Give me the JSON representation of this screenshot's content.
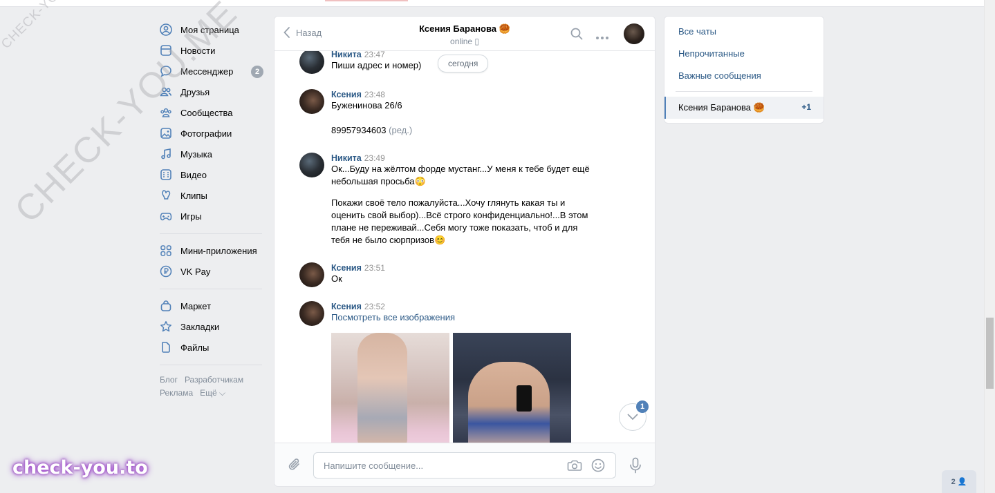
{
  "nav": {
    "items": [
      {
        "label": "Моя страница",
        "icon": "user-circle-icon"
      },
      {
        "label": "Новости",
        "icon": "news-icon"
      },
      {
        "label": "Мессенджер",
        "icon": "message-icon",
        "badge": "2"
      },
      {
        "label": "Друзья",
        "icon": "friends-icon"
      },
      {
        "label": "Сообщества",
        "icon": "communities-icon"
      },
      {
        "label": "Фотографии",
        "icon": "photos-icon"
      },
      {
        "label": "Музыка",
        "icon": "music-icon"
      },
      {
        "label": "Видео",
        "icon": "video-icon"
      },
      {
        "label": "Клипы",
        "icon": "clips-icon"
      },
      {
        "label": "Игры",
        "icon": "games-icon"
      },
      {
        "label": "Мини-приложения",
        "icon": "apps-icon"
      },
      {
        "label": "VK Pay",
        "icon": "vkpay-icon"
      },
      {
        "label": "Маркет",
        "icon": "market-icon"
      },
      {
        "label": "Закладки",
        "icon": "star-icon"
      },
      {
        "label": "Файлы",
        "icon": "file-icon"
      }
    ],
    "footer": {
      "blog": "Блог",
      "devs": "Разработчикам",
      "ads": "Реклама",
      "more": "Ещё ⌵"
    }
  },
  "chat": {
    "back_label": "Назад",
    "title": "Ксения Баранова 🥮",
    "status": "online ▯",
    "today_label": "сегодня",
    "messages": [
      {
        "author": "Никита",
        "time": "23:47",
        "text": "Пиши адрес и номер)"
      },
      {
        "author": "Ксения",
        "time": "23:48",
        "text": "Буженинова 26/6",
        "text2": "89957934603",
        "edited": "(ред.)"
      },
      {
        "author": "Никита",
        "time": "23:49",
        "text_l1": "Ок...Буду на жёлтом форде мустанг...У меня к тебе будет ещё",
        "text_l2": "небольшая просьба😳",
        "text2_l1": "Покажи своё тело пожалуйста...Хочу глянуть какая ты и",
        "text2_l2": "оценить свой выбор)...Всё строго конфиденциально!...В этом",
        "text2_l3": "плане не переживай...Себя могу тоже показать, чтоб и для",
        "text2_l4": "тебя не было сюрпризов😊"
      },
      {
        "author": "Ксения",
        "time": "23:51",
        "text": "Ок"
      },
      {
        "author": "Ксения",
        "time": "23:52",
        "link": "Посмотреть все изображения"
      }
    ],
    "unread_count": "1",
    "composer_placeholder": "Напишите сообщение..."
  },
  "right": {
    "all_chats": "Все чаты",
    "unread": "Непрочитанные",
    "important": "Важные сообщения",
    "active_chat": "Ксения Баранова 🥮",
    "active_count": "+1"
  },
  "online_count": "2 👤",
  "watermarks": {
    "small": "CHECK-YOU.ME",
    "big": "CHECK-YOU.ME",
    "badge": "check-you.to"
  }
}
